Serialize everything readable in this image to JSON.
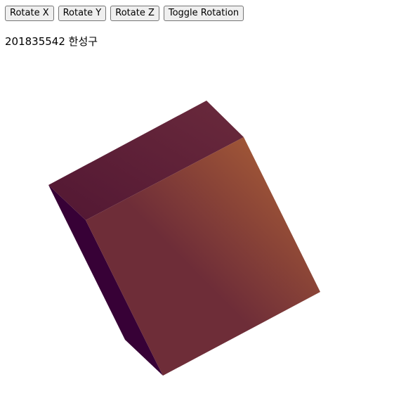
{
  "toolbar": {
    "rotate_x_label": "Rotate X",
    "rotate_y_label": "Rotate Y",
    "rotate_z_label": "Rotate Z",
    "toggle_rotation_label": "Toggle Rotation"
  },
  "caption": {
    "text": "201835542 한성구"
  },
  "cube": {
    "colors": {
      "top_face_start": "#521733",
      "top_face_end": "#6a2a3c",
      "front_face_start": "#b36636",
      "front_face_end": "#6e2d38",
      "left_face": "#370136"
    }
  }
}
